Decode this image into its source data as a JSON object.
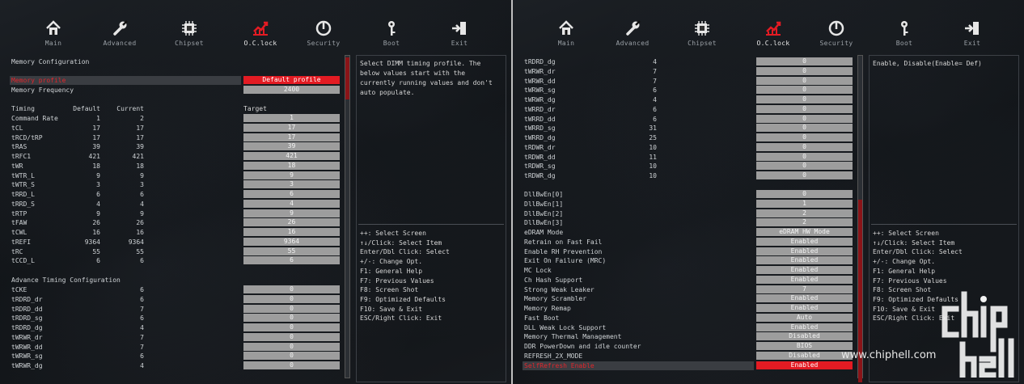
{
  "menu": [
    {
      "label": "Main",
      "icon": "home-icon",
      "active": false
    },
    {
      "label": "Advanced",
      "icon": "wrench-icon",
      "active": false
    },
    {
      "label": "Chipset",
      "icon": "chip-icon",
      "active": false
    },
    {
      "label": "O.C.lock",
      "icon": "oc-chart-icon",
      "active": true
    },
    {
      "label": "Security",
      "icon": "shield-icon",
      "active": false
    },
    {
      "label": "Boot",
      "icon": "key-icon",
      "active": false
    },
    {
      "label": "Exit",
      "icon": "exit-door-icon",
      "active": false
    }
  ],
  "left": {
    "section_title": "Memory Configuration",
    "profile": {
      "label": "Memory profile",
      "value": "Default profile"
    },
    "frequency": {
      "label": "Memory Frequency",
      "value": "2400"
    },
    "headers": {
      "timing": "Timing",
      "default": "Default",
      "current": "Current",
      "target": "Target"
    },
    "timings": [
      {
        "name": "Command Rate",
        "default": "1",
        "current": "2",
        "target": "1"
      },
      {
        "name": "tCL",
        "default": "17",
        "current": "17",
        "target": "17"
      },
      {
        "name": "tRCD/tRP",
        "default": "17",
        "current": "17",
        "target": "17"
      },
      {
        "name": "tRAS",
        "default": "39",
        "current": "39",
        "target": "39"
      },
      {
        "name": "tRFC1",
        "default": "421",
        "current": "421",
        "target": "421"
      },
      {
        "name": "tWR",
        "default": "18",
        "current": "18",
        "target": "18"
      },
      {
        "name": "tWTR_L",
        "default": "9",
        "current": "9",
        "target": "9"
      },
      {
        "name": "tWTR_S",
        "default": "3",
        "current": "3",
        "target": "3"
      },
      {
        "name": "tRRD_L",
        "default": "6",
        "current": "6",
        "target": "6"
      },
      {
        "name": "tRRD_S",
        "default": "4",
        "current": "4",
        "target": "4"
      },
      {
        "name": "tRTP",
        "default": "9",
        "current": "9",
        "target": "9"
      },
      {
        "name": "tFAW",
        "default": "26",
        "current": "26",
        "target": "26"
      },
      {
        "name": "tCWL",
        "default": "16",
        "current": "16",
        "target": "16"
      },
      {
        "name": "tREFI",
        "default": "9364",
        "current": "9364",
        "target": "9364"
      },
      {
        "name": "tRC",
        "default": "55",
        "current": "55",
        "target": "55"
      },
      {
        "name": "tCCD_L",
        "default": "6",
        "current": "6",
        "target": "6"
      }
    ],
    "advance_title": "Advance Timing Configuration",
    "advance": [
      {
        "name": "tCKE",
        "current": "6",
        "target": "0"
      },
      {
        "name": "tRDRD_dr",
        "current": "6",
        "target": "0"
      },
      {
        "name": "tRDRD_dd",
        "current": "7",
        "target": "0"
      },
      {
        "name": "tRDRD_sg",
        "current": "6",
        "target": "0"
      },
      {
        "name": "tRDRD_dg",
        "current": "4",
        "target": "0"
      },
      {
        "name": "tWRWR_dr",
        "current": "7",
        "target": "0"
      },
      {
        "name": "tWRWR_dd",
        "current": "7",
        "target": "0"
      },
      {
        "name": "tWRWR_sg",
        "current": "6",
        "target": "0"
      },
      {
        "name": "tWRWR_dg",
        "current": "4",
        "target": "0"
      }
    ],
    "help": "Select DIMM timing profile. The below values start with the currently running values and don't auto populate."
  },
  "right": {
    "timings": [
      {
        "name": "tRDRD_dg",
        "current": "4",
        "target": "0"
      },
      {
        "name": "tWRWR_dr",
        "current": "7",
        "target": "0"
      },
      {
        "name": "tWRWR_dd",
        "current": "7",
        "target": "0"
      },
      {
        "name": "tWRWR_sg",
        "current": "6",
        "target": "0"
      },
      {
        "name": "tWRWR_dg",
        "current": "4",
        "target": "0"
      },
      {
        "name": "tWRRD_dr",
        "current": "6",
        "target": "0"
      },
      {
        "name": "tWRRD_dd",
        "current": "6",
        "target": "0"
      },
      {
        "name": "tWRRD_sg",
        "current": "31",
        "target": "0"
      },
      {
        "name": "tWRRD_dg",
        "current": "25",
        "target": "0"
      },
      {
        "name": "tRDWR_dr",
        "current": "10",
        "target": "0"
      },
      {
        "name": "tRDWR_dd",
        "current": "11",
        "target": "0"
      },
      {
        "name": "tRDWR_sg",
        "current": "10",
        "target": "0"
      },
      {
        "name": "tRDWR_dg",
        "current": "10",
        "target": "0"
      }
    ],
    "dllbw": [
      {
        "name": "DllBwEn[0]",
        "value": "0"
      },
      {
        "name": "DllBwEn[1]",
        "value": "1"
      },
      {
        "name": "DllBwEn[2]",
        "value": "2"
      },
      {
        "name": "DllBwEn[3]",
        "value": "2"
      }
    ],
    "options": [
      {
        "name": "eDRAM Mode",
        "value": "eDRAM HW Mode"
      },
      {
        "name": "Retrain on Fast Fail",
        "value": "Enabled"
      },
      {
        "name": "Enable RH Prevention",
        "value": "Enabled"
      },
      {
        "name": "Exit On Failure (MRC)",
        "value": "Enabled"
      },
      {
        "name": "MC Lock",
        "value": "Enabled"
      },
      {
        "name": "Ch Hash Support",
        "value": "Enabled"
      },
      {
        "name": "Strong Weak Leaker",
        "value": "7"
      },
      {
        "name": "Memory Scrambler",
        "value": "Enabled"
      },
      {
        "name": "Memory Remap",
        "value": "Enabled"
      },
      {
        "name": "Fast Boot",
        "value": "Auto"
      },
      {
        "name": "DLL Weak Lock Support",
        "value": "Enabled"
      },
      {
        "name": "Memory Thermal Management",
        "value": "Disabled"
      },
      {
        "name": "DDR PowerDown and idle counter",
        "value": "BIOS"
      },
      {
        "name": "REFRESH_2X_MODE",
        "value": "Disabled"
      },
      {
        "name": "SelfRefresh Enable",
        "value": "Enabled"
      }
    ],
    "help": "Enable, Disable(Enable= Def)"
  },
  "keys": [
    "++: Select Screen",
    "↑↓/Click: Select Item",
    "Enter/Dbl Click: Select",
    "+/-: Change Opt.",
    "F1: General Help",
    "F7: Previous Values",
    "F8: Screen Shot",
    "F9: Optimized Defaults",
    "F10: Save & Exit",
    "ESC/Right Click: Exit"
  ],
  "watermark": {
    "url": "www.chiphell.com"
  },
  "colors": {
    "accent_red": "#e31b23",
    "value_box": "#9d9d9d",
    "background": "#111418"
  }
}
